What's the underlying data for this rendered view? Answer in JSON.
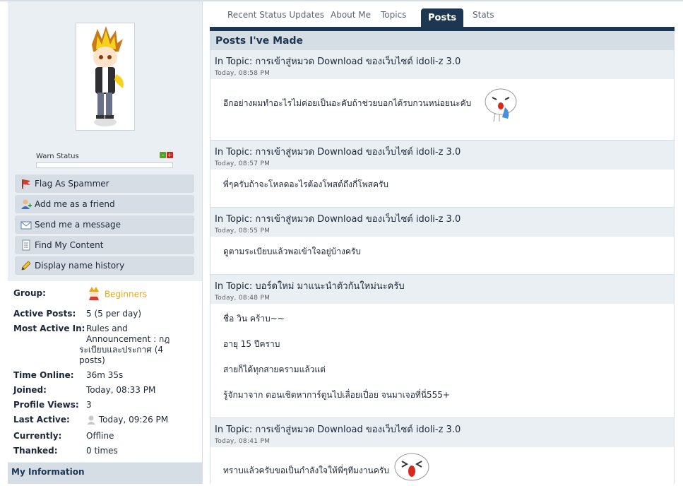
{
  "sidebar": {
    "warn_status": "Warn Status",
    "actions": [
      {
        "label": "Flag As Spammer",
        "icon": "flag-icon"
      },
      {
        "label": "Add me as a friend",
        "icon": "add-friend-icon"
      },
      {
        "label": "Send me a message",
        "icon": "envelope-icon"
      },
      {
        "label": "Find My Content",
        "icon": "document-icon"
      },
      {
        "label": "Display name history",
        "icon": "pencil-icon"
      }
    ],
    "info": {
      "group_label": "Group:",
      "group_value": "Beginners",
      "active_posts_label": "Active Posts:",
      "active_posts_value": "5 (5 per day)",
      "most_active_label": "Most Active In:",
      "most_active_line1": "Rules and",
      "most_active_line2": "Announcement : กฎ",
      "most_active_line3": "ระเบียบและประกาศ (4",
      "most_active_line4": "posts)",
      "time_online_label": "Time Online:",
      "time_online_value": "36m 35s",
      "joined_label": "Joined:",
      "joined_value": "Today, 08:33 PM",
      "profile_views_label": "Profile Views:",
      "profile_views_value": "3",
      "last_active_label": "Last Active:",
      "last_active_value": "Today, 09:26 PM",
      "currently_label": "Currently:",
      "currently_value": "Offline",
      "thanked_label": "Thanked:",
      "thanked_value": "0 times"
    },
    "my_information": "My Information"
  },
  "tabs": [
    "Recent Status Updates",
    "About Me",
    "Topics",
    "Posts",
    "Stats"
  ],
  "main": {
    "heading": "Posts I've Made",
    "posts": [
      {
        "title": "In Topic: การเข้าสู่หมวด Download ของเว็บไซต์ idoli-z 3.0",
        "date": "Today, 08:58 PM",
        "lines": [
          "อีกอย่างผมทำอะไรไม่ค่อยเป็นอะคับถ้าช่วยบอกได้รบกวนหน่อยนะคับ"
        ]
      },
      {
        "title": "In Topic: การเข้าสู่หมวด Download ของเว็บไซต์ idoli-z 3.0",
        "date": "Today, 08:57 PM",
        "lines": [
          "พี่ๆครับถ้าจะโหลดอะไรต้องโพสต์ถึงกี่โพสครับ"
        ]
      },
      {
        "title": "In Topic: การเข้าสู่หมวด Download ของเว็บไซต์ idoli-z 3.0",
        "date": "Today, 08:55 PM",
        "lines": [
          "ดูตามระเบียบแล้วพอเข้าใจอยู่บ้างครับ"
        ]
      },
      {
        "title": "In Topic: บอร์ดใหม่ มาแนะนำตัวกันใหม่นะครับ",
        "date": "Today, 08:48 PM",
        "lines": [
          "ชื่อ วิน คร้าบ~~",
          "อายุ 15 ปีคราบ",
          "สายก็ได้ทุกสายครามแล้วแต่",
          "รู้จักมาจาก ตอนเชิตหาการ์ตูนไปเลื่อยเปื่อย จนมาเจอที่นี่555+"
        ]
      },
      {
        "title": "In Topic: การเข้าสู่หมวด Download ของเว็บไซต์ idoli-z 3.0",
        "date": "Today, 08:41 PM",
        "lines": [
          "ทราบแล้วครับขอเป็นกำลังใจให้พี่ๆทีมงานครับ"
        ]
      }
    ]
  },
  "colors": {
    "accent": "#1d3652",
    "sidebar_bg": "#eaeff3",
    "header_bg": "#d5dde5",
    "group": "#e6a817"
  }
}
